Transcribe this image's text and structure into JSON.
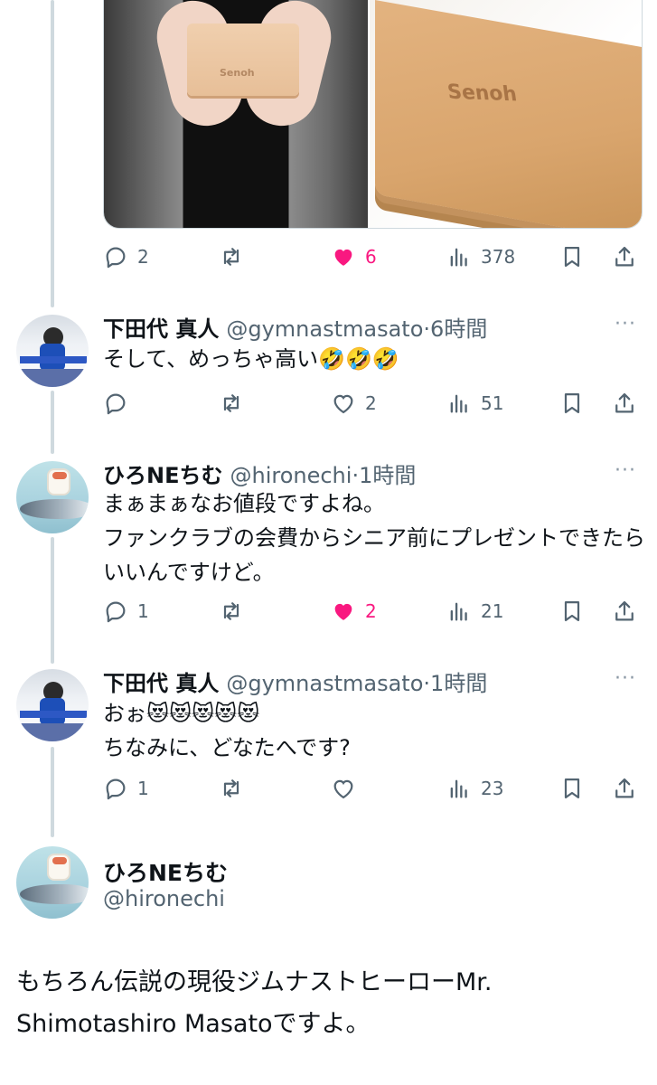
{
  "media": {
    "left_brand": "Senoh",
    "right_brand": "Senoh"
  },
  "tweets": [
    {
      "actions": {
        "replies": "2",
        "retweets": "",
        "likes": "6",
        "views": "378",
        "liked": true
      }
    },
    {
      "name": "下田代 真人",
      "handle": "@gymnastmasato",
      "dot": "·",
      "time": "6時間",
      "text": "そして、めっちゃ高い🤣🤣🤣",
      "actions": {
        "replies": "",
        "retweets": "",
        "likes": "2",
        "views": "51",
        "liked": false
      }
    },
    {
      "name": "ひろNEちむ",
      "handle": "@hironechi",
      "dot": "·",
      "time": "1時間",
      "text": "まぁまぁなお値段ですよね。\nファンクラブの会費からシニア前にプレゼントできたらいいんですけど。",
      "actions": {
        "replies": "1",
        "retweets": "",
        "likes": "2",
        "views": "21",
        "liked": true
      }
    },
    {
      "name": "下田代 真人",
      "handle": "@gymnastmasato",
      "dot": "·",
      "time": "1時間",
      "text": "おぉ😻😻😻😻😻\nちなみに、どなたへです?",
      "actions": {
        "replies": "1",
        "retweets": "",
        "likes": "",
        "views": "23",
        "liked": false
      }
    }
  ],
  "focused_tweet": {
    "name": "ひろNEちむ",
    "handle": "@hironechi",
    "text": "もちろん伝説の現役ジムナストヒーローMr. Shimotashiro Masatoですよ。"
  },
  "more_label": "···",
  "colors": {
    "like": "#f91880",
    "muted": "#536471",
    "thread": "#cfd9de"
  }
}
